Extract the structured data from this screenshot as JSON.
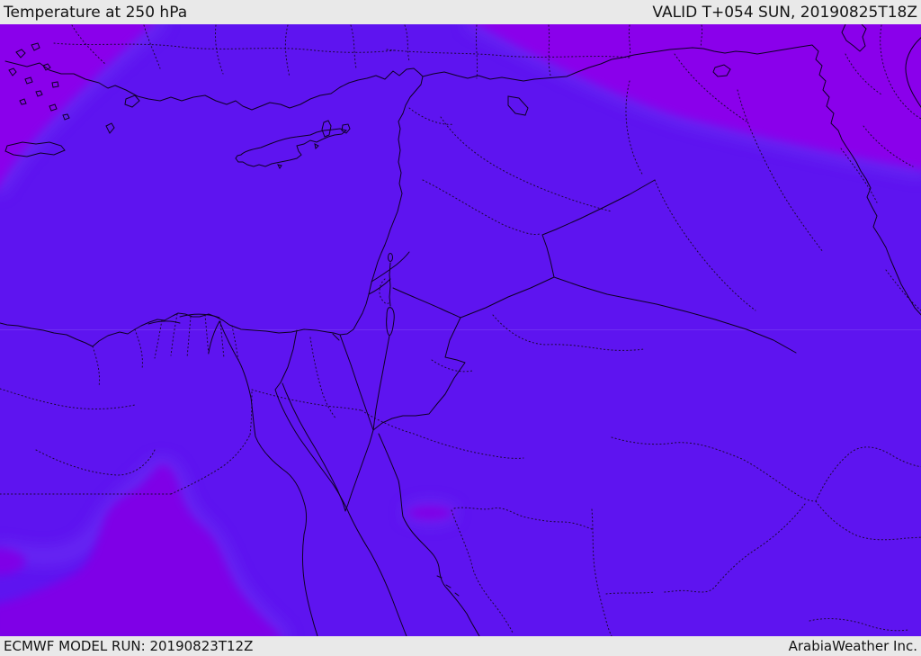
{
  "header": {
    "title": "Temperature at 250 hPa",
    "valid": "VALID T+054 SUN, 20190825T18Z"
  },
  "footer": {
    "model_run": "ECMWF MODEL RUN: 20190823T12Z",
    "credit": "ArabiaWeather Inc."
  },
  "map": {
    "description": "Temperature shading at 250 hPa over the Eastern Mediterranean and Middle East",
    "colors": {
      "band_base": "#5e14f0",
      "band_cold_north": "#8a06eb",
      "band_transition_halo": "#6c31f4",
      "band_patch_south": "#7f02e7",
      "coastline": "#0e0023",
      "admin_dots": "#1c0836",
      "bar_bg": "#e9e9e9",
      "bar_text": "#141414"
    },
    "shaded_regions": [
      {
        "name": "northwest-band",
        "location": "upper-left corner (Aegean / west Turkey)"
      },
      {
        "name": "northeast-band",
        "location": "upper-right (east Turkey / Iran / Caspian)"
      },
      {
        "name": "southwest-patch",
        "location": "lower-left (southern Egypt / Nile valley)"
      },
      {
        "name": "red-sea-patch",
        "location": "small oval east of the Red Sea coast"
      }
    ]
  }
}
